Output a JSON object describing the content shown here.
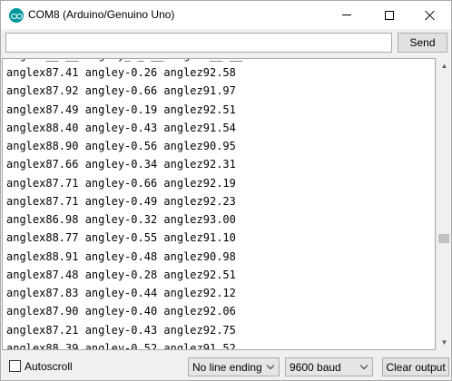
{
  "window": {
    "title": "COM8 (Arduino/Genuino Uno)",
    "icon": "arduino-logo-icon",
    "controls": [
      "minimize-icon",
      "maximize-icon",
      "close-icon"
    ]
  },
  "send": {
    "input_value": "",
    "button_label": "Send"
  },
  "output": {
    "lines": [
      "anglex87.41 angley-0.26 anglez92.58",
      "anglex87.92 angley-0.66 anglez91.97",
      "anglex87.49 angley-0.19 anglez92.51",
      "anglex88.40 angley-0.43 anglez91.54",
      "anglex88.90 angley-0.56 anglez90.95",
      "anglex87.66 angley-0.34 anglez92.31",
      "anglex87.71 angley-0.66 anglez92.19",
      "anglex87.71 angley-0.49 anglez92.23",
      "anglex86.98 angley-0.32 anglez93.00",
      "anglex88.77 angley-0.55 anglez91.10",
      "anglex88.91 angley-0.48 anglez90.98",
      "anglex87.48 angley-0.28 anglez92.51",
      "anglex87.83 angley-0.44 anglez92.12",
      "anglex87.90 angley-0.40 anglez92.06",
      "anglex87.21 angley-0.43 anglez92.75",
      "anglex88.39 angley-0.52 anglez91.52"
    ]
  },
  "bottom": {
    "autoscroll_label": "Autoscroll",
    "autoscroll_checked": false,
    "line_ending_selected": "No line ending",
    "baud_selected": "9600 baud",
    "clear_label": "Clear output"
  },
  "colors": {
    "arduino_teal": "#00979d",
    "window_bg": "#f0f0f0"
  }
}
